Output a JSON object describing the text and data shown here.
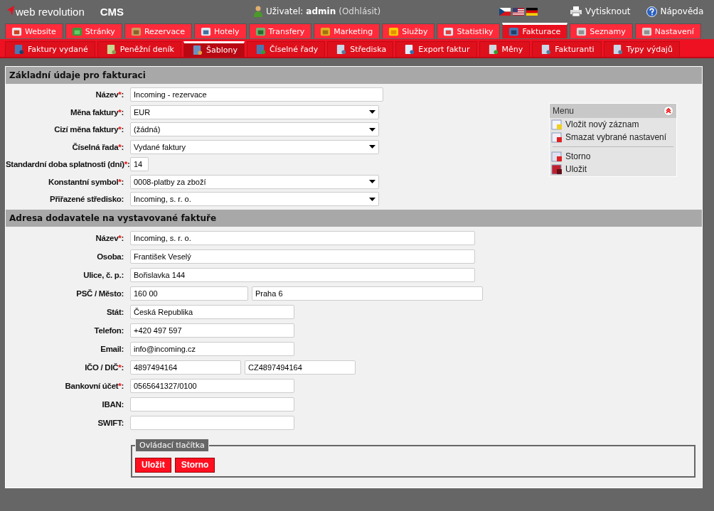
{
  "header": {
    "brand": "web revolution",
    "product": "CMS",
    "user_label": "Uživatel:",
    "user_name": "admin",
    "logout": "(Odhlásit)",
    "print": "Vytisknout",
    "help": "Nápověda"
  },
  "main_tabs": [
    {
      "label": "Website",
      "selected": false
    },
    {
      "label": "Stránky",
      "selected": false
    },
    {
      "label": "Rezervace",
      "selected": false
    },
    {
      "label": "Hotely",
      "selected": false
    },
    {
      "label": "Transfery",
      "selected": false
    },
    {
      "label": "Marketing",
      "selected": false
    },
    {
      "label": "Služby",
      "selected": false
    },
    {
      "label": "Statistiky",
      "selected": false
    },
    {
      "label": "Fakturace",
      "selected": true
    },
    {
      "label": "Seznamy",
      "selected": false
    },
    {
      "label": "Nastavení",
      "selected": false
    }
  ],
  "sub_tabs": [
    {
      "label": "Faktury vydané",
      "selected": false
    },
    {
      "label": "Peněžní deník",
      "selected": false
    },
    {
      "label": "Šablony",
      "selected": true
    },
    {
      "label": "Číselné řady",
      "selected": false
    },
    {
      "label": "Střediska",
      "selected": false
    },
    {
      "label": "Export faktur",
      "selected": false
    },
    {
      "label": "Měny",
      "selected": false
    },
    {
      "label": "Fakturanti",
      "selected": false
    },
    {
      "label": "Typy výdajů",
      "selected": false
    }
  ],
  "required_mark": "*",
  "label_suffix": ":",
  "sections": [
    {
      "title": "Základní údaje pro fakturaci",
      "fields": [
        {
          "label": "Název",
          "required": true,
          "kind": "text",
          "values": [
            "Incoming - rezervace"
          ]
        },
        {
          "label": "Měna faktury",
          "required": true,
          "kind": "select",
          "values": [
            "EUR"
          ]
        },
        {
          "label": "Cizí měna faktury",
          "required": true,
          "kind": "select",
          "values": [
            "(žádná)"
          ]
        },
        {
          "label": "Číselná řada",
          "required": true,
          "kind": "select",
          "values": [
            "Vydané faktury"
          ]
        },
        {
          "label": "Standardní doba splatnosti (dní)",
          "required": true,
          "kind": "tiny",
          "values": [
            "14"
          ]
        },
        {
          "label": "Konstantní symbol",
          "required": true,
          "kind": "select",
          "values": [
            "0008-platby za zboží"
          ]
        },
        {
          "label": "Přiřazené středisko",
          "required": false,
          "kind": "select",
          "values": [
            "Incoming, s. r. o."
          ]
        }
      ]
    },
    {
      "title": "Adresa dodavatele na vystavované faktuře",
      "fields": [
        {
          "label": "Název",
          "required": true,
          "kind": "wide",
          "values": [
            "Incoming, s. r. o."
          ]
        },
        {
          "label": "Osoba",
          "required": false,
          "kind": "wide",
          "values": [
            "František Veselý"
          ]
        },
        {
          "label": "Ulice, č. p.",
          "required": false,
          "kind": "wide",
          "values": [
            "Bořislavka 144"
          ]
        },
        {
          "label": "PSČ / Město",
          "required": false,
          "kind": "city",
          "values": [
            "160 00",
            "Praha 6"
          ]
        },
        {
          "label": "Stát",
          "required": false,
          "kind": "medium",
          "values": [
            "Česká Republika"
          ]
        },
        {
          "label": "Telefon",
          "required": false,
          "kind": "medium",
          "values": [
            "+420 497 597"
          ]
        },
        {
          "label": "Email",
          "required": false,
          "kind": "medium",
          "values": [
            "info@incoming.cz"
          ]
        },
        {
          "label": "IČO / DIČ",
          "required": true,
          "kind": "pair",
          "values": [
            "4897494164",
            "CZ4897494164"
          ]
        },
        {
          "label": "Bankovní účet",
          "required": true,
          "kind": "medium",
          "values": [
            "0565641327/0100"
          ]
        },
        {
          "label": "IBAN",
          "required": false,
          "kind": "medium"
        },
        {
          "label": "SWIFT",
          "required": false,
          "kind": "medium"
        }
      ]
    }
  ],
  "menu": {
    "title": "Menu",
    "items": [
      {
        "kind": "item",
        "label": "Vložit nový záznam"
      },
      {
        "kind": "item",
        "label": "Smazat vybrané nastavení"
      },
      {
        "kind": "separator"
      },
      {
        "kind": "item",
        "label": "Storno"
      },
      {
        "kind": "item",
        "label": "Uložit"
      }
    ]
  },
  "controls": {
    "legend": "Ovládací tlačítka",
    "buttons": [
      "Uložit",
      "Storno"
    ]
  }
}
